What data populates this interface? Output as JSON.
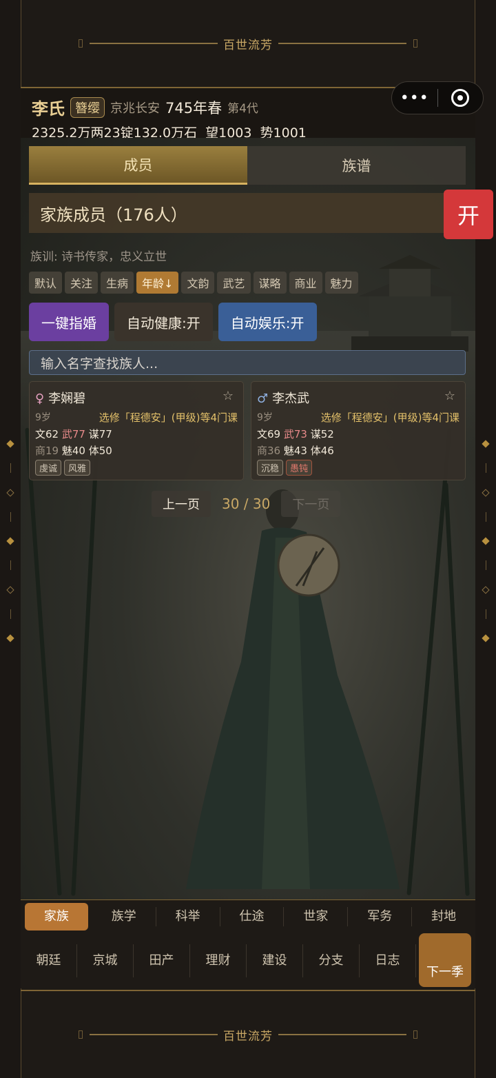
{
  "banner": {
    "top_text": "百世流芳",
    "bottom_text": "百世流芳"
  },
  "header": {
    "surname": "李氏",
    "rank": "簪缨",
    "place": "京兆长安",
    "year": "745年春",
    "generation": "第4代",
    "money": "2325.2万两",
    "ingots": "23锭",
    "grain": "132.0万石",
    "prestige": "望1003",
    "power": "势1001"
  },
  "capsule": {
    "more": "•••"
  },
  "tabs": [
    {
      "label": "成员"
    },
    {
      "label": "族谱"
    }
  ],
  "section": {
    "title": "家族成员（176人）",
    "open_label": "开"
  },
  "motto": "族训: 诗书传家，忠义立世",
  "sort_chips": [
    "默认",
    "关注",
    "生病",
    "年龄↓",
    "文韵",
    "武艺",
    "谋略",
    "商业",
    "魅力"
  ],
  "actions": {
    "marry": "一键指婚",
    "health": "自动健康:开",
    "fun": "自动娱乐:开"
  },
  "search": {
    "placeholder": "输入名字查找族人..."
  },
  "members": [
    {
      "gender": "♀",
      "name": "李娴碧",
      "star": "☆",
      "age": "9岁",
      "course": "选修「程德安」(甲级)等4门课",
      "wen": "文62",
      "wu": "武77",
      "mou": "谋77",
      "shang": "商19",
      "mei": "魅40",
      "ti": "体50",
      "traits": [
        "虔诚",
        "风雅"
      ]
    },
    {
      "gender": "♂",
      "name": "李杰武",
      "star": "☆",
      "age": "9岁",
      "course": "选修「程德安」(甲级)等4门课",
      "wen": "文69",
      "wu": "武73",
      "mou": "谋52",
      "shang": "商36",
      "mei": "魅43",
      "ti": "体46",
      "traits": [
        "沉稳",
        "愚钝"
      ]
    }
  ],
  "pager": {
    "prev": "上一页",
    "page": "30 / 30",
    "next": "下一页"
  },
  "nav_primary": [
    "家族",
    "族学",
    "科举",
    "仕途",
    "世家",
    "军务",
    "封地"
  ],
  "nav_secondary": [
    "朝廷",
    "京城",
    "田产",
    "理财",
    "建设",
    "分支",
    "日志"
  ],
  "next_season": "下一季",
  "colors": {
    "accent": "#b07a33",
    "gold": "#c9a865",
    "red_button": "#d4383a",
    "purple": "#6b3fa0",
    "blue": "#3a5f97"
  }
}
